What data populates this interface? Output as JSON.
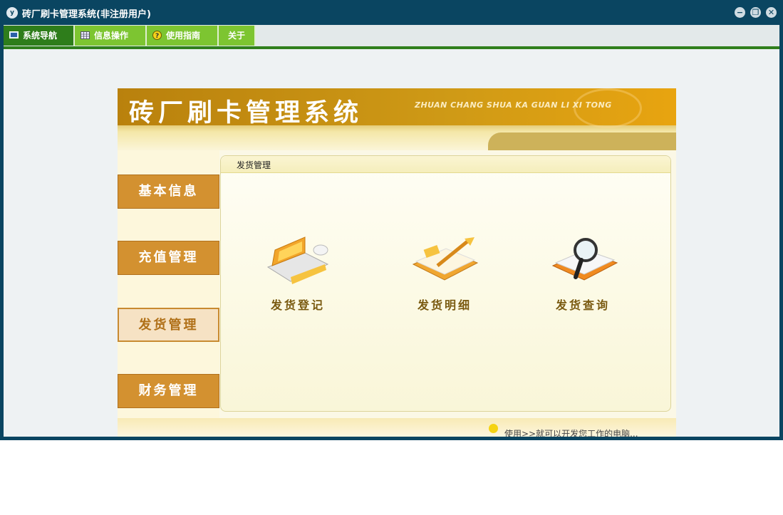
{
  "window": {
    "icon_text": "y",
    "title": "砖厂刷卡管理系统(非注册用户)",
    "controls": {
      "minimize": "−",
      "restore": "❐",
      "close": "✕"
    }
  },
  "menubar": {
    "items": [
      {
        "label": "系统导航",
        "icon": "monitor-icon",
        "active": true
      },
      {
        "label": "信息操作",
        "icon": "grid-icon",
        "active": false
      },
      {
        "label": "使用指南",
        "icon": "help-icon",
        "active": false
      },
      {
        "label": "关于",
        "icon": "",
        "active": false
      }
    ]
  },
  "banner": {
    "title": "砖厂刷卡管理系统",
    "subtitle": "ZHUAN CHANG SHUA KA GUAN LI XI TONG"
  },
  "sidebar": {
    "items": [
      {
        "label": "基本信息",
        "active": false
      },
      {
        "label": "充值管理",
        "active": false
      },
      {
        "label": "发货管理",
        "active": true
      },
      {
        "label": "财务管理",
        "active": false
      }
    ]
  },
  "content": {
    "title": "发货管理",
    "tiles": [
      {
        "label": "发货登记",
        "icon": "laptop-icon"
      },
      {
        "label": "发货明细",
        "icon": "notebook-pen-icon"
      },
      {
        "label": "发货查询",
        "icon": "magnifier-book-icon"
      }
    ]
  },
  "footer": {
    "text": "使用>>就可以开发您工作的电脑..."
  },
  "colors": {
    "titlebar": "#0a4561",
    "menu_green": "#7dc531",
    "menu_active": "#2e7d1b",
    "side_button": "#d39130"
  }
}
